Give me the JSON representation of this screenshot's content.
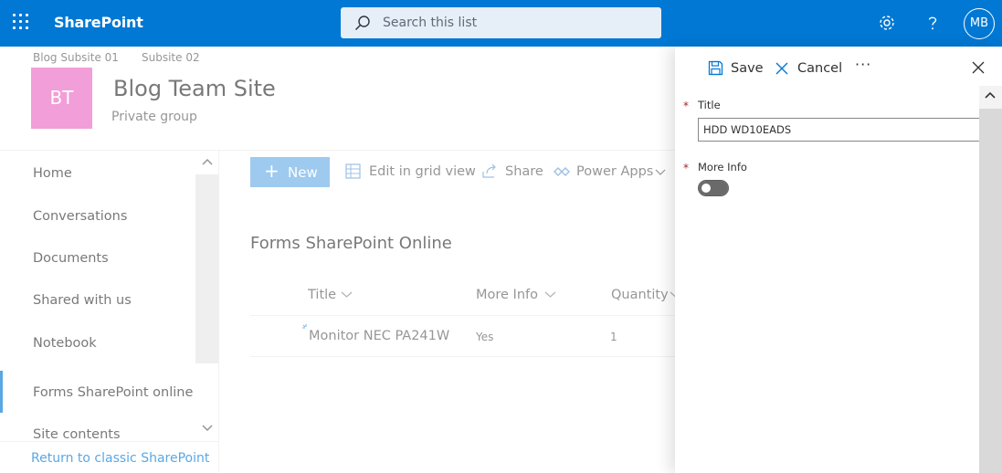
{
  "suite": {
    "app_name": "SharePoint",
    "search_placeholder": "Search this list",
    "avatar_initials": "MB",
    "accent": "#0078d4"
  },
  "site": {
    "subnav": [
      "Blog Subsite 01",
      "Subsite 02"
    ],
    "logo_initials": "BT",
    "logo_color": "#ec6bc4",
    "title": "Blog Team Site",
    "subtitle": "Private group"
  },
  "leftnav": {
    "items": [
      {
        "label": "Home"
      },
      {
        "label": "Conversations"
      },
      {
        "label": "Documents"
      },
      {
        "label": "Shared with us"
      },
      {
        "label": "Notebook"
      },
      {
        "label": "Forms SharePoint online"
      },
      {
        "label": "Site contents"
      }
    ],
    "selected_index": 5,
    "classic_link": "Return to classic SharePoint"
  },
  "commandbar": {
    "new_label": "New",
    "edit_grid_label": "Edit in grid view",
    "share_label": "Share",
    "power_apps_label": "Power Apps"
  },
  "list": {
    "title": "Forms SharePoint Online",
    "columns": [
      "Title",
      "More Info",
      "Quantity"
    ],
    "rows": [
      {
        "title": "Monitor NEC PA241W",
        "more_info": "Yes",
        "quantity": "1"
      }
    ]
  },
  "panel": {
    "save_label": "Save",
    "cancel_label": "Cancel",
    "more_label": "···",
    "fields": [
      {
        "label": "Title",
        "required_mark": "*",
        "value": "HDD WD10EADS"
      },
      {
        "label": "More Info",
        "required_mark": "*",
        "toggle_on": false
      }
    ]
  }
}
